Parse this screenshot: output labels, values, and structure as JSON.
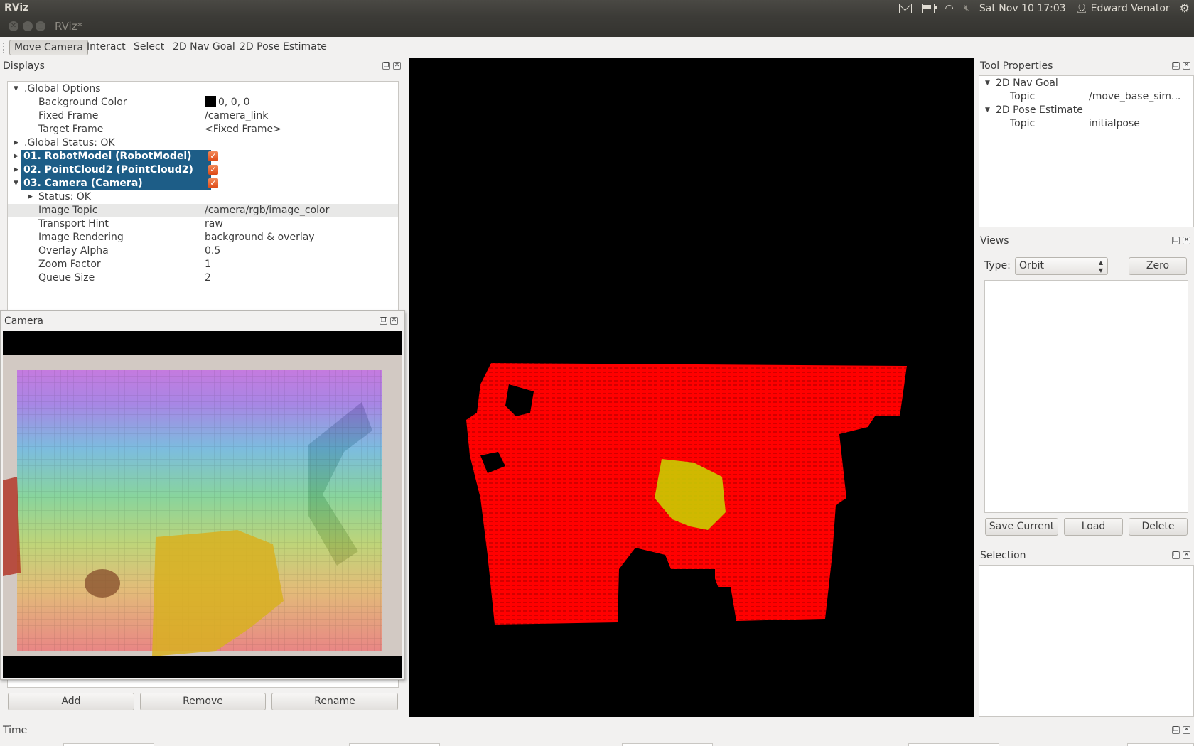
{
  "top_panel": {
    "app_name": "RViz",
    "datetime": "Sat Nov 10 17:03",
    "user": "Edward Venator"
  },
  "window": {
    "title": "RViz*"
  },
  "toolbar": {
    "tools": [
      "Move Camera",
      "Interact",
      "Select",
      "2D Nav Goal",
      "2D Pose Estimate"
    ],
    "active_tool": "Move Camera"
  },
  "displays": {
    "title": "Displays",
    "global_options": {
      "label": ".Global Options",
      "background_color_label": "Background Color",
      "background_color_value": "0, 0, 0",
      "fixed_frame_label": "Fixed Frame",
      "fixed_frame_value": "/camera_link",
      "target_frame_label": "Target Frame",
      "target_frame_value": "<Fixed Frame>"
    },
    "global_status": ".Global Status: OK",
    "items": [
      {
        "label": "01. RobotModel (RobotModel)",
        "checked": true
      },
      {
        "label": "02. PointCloud2 (PointCloud2)",
        "checked": true
      },
      {
        "label": "03. Camera (Camera)",
        "checked": true
      }
    ],
    "camera_props": {
      "status": "Status: OK",
      "image_topic_label": "Image Topic",
      "image_topic_value": "/camera/rgb/image_color",
      "transport_hint_label": "Transport Hint",
      "transport_hint_value": "raw",
      "image_rendering_label": "Image Rendering",
      "image_rendering_value": "background & overlay",
      "overlay_alpha_label": "Overlay Alpha",
      "overlay_alpha_value": "0.5",
      "zoom_factor_label": "Zoom Factor",
      "zoom_factor_value": "1",
      "queue_size_label": "Queue Size",
      "queue_size_value": "2"
    },
    "buttons": {
      "add": "Add",
      "remove": "Remove",
      "rename": "Rename"
    }
  },
  "camera_panel": {
    "title": "Camera"
  },
  "tool_properties": {
    "title": "Tool Properties",
    "nav_goal_label": "2D Nav Goal",
    "nav_goal_topic_label": "Topic",
    "nav_goal_topic_value": "/move_base_sim...",
    "pose_estimate_label": "2D Pose Estimate",
    "pose_estimate_topic_label": "Topic",
    "pose_estimate_topic_value": "initialpose"
  },
  "views": {
    "title": "Views",
    "type_label": "Type:",
    "type_value": "Orbit",
    "zero_button": "Zero",
    "save_current_button": "Save Current",
    "load_button": "Load",
    "delete_button": "Delete"
  },
  "selection": {
    "title": "Selection"
  },
  "time": {
    "title": "Time"
  },
  "colors": {
    "selection_blue": "#1d5d87",
    "checkbox_orange": "#dd4814",
    "viewport_background": "#000000"
  },
  "icons": [
    "mail-icon",
    "battery-icon",
    "wifi-icon",
    "volume-muted-icon",
    "user-icon",
    "gear-icon"
  ]
}
